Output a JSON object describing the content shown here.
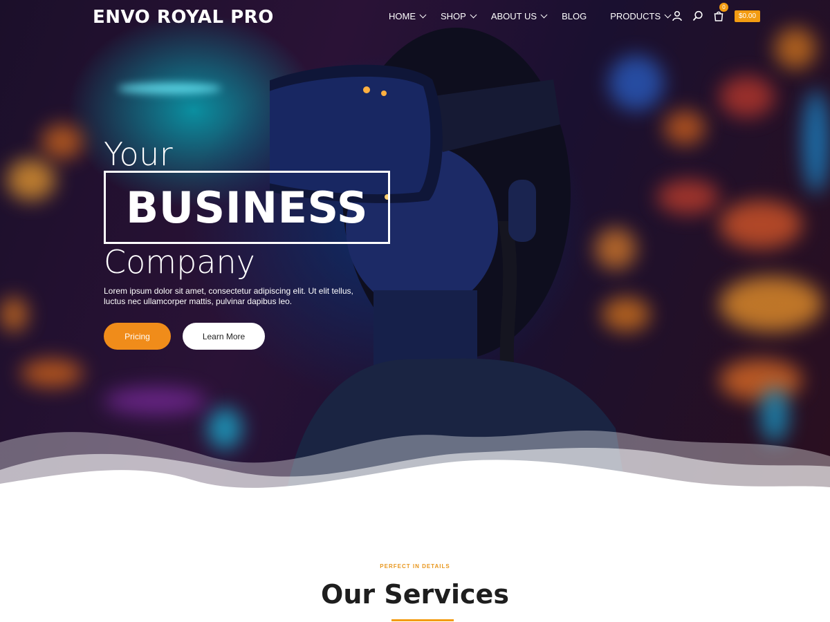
{
  "brand": {
    "logo_text": "ENVO ROYAL PRO"
  },
  "nav": {
    "items": [
      {
        "label": "HOME",
        "has_dropdown": true
      },
      {
        "label": "SHOP",
        "has_dropdown": true
      },
      {
        "label": "ABOUT US",
        "has_dropdown": true
      },
      {
        "label": "BLOG",
        "has_dropdown": false
      },
      {
        "label": "PRODUCTS",
        "has_dropdown": true
      }
    ],
    "icons": [
      "user-icon",
      "search-icon",
      "cart-icon"
    ],
    "cart_count": "0",
    "cart_total": "$0.00"
  },
  "hero": {
    "line1": "Your",
    "line2": "BUSINESS",
    "line3": "Company",
    "description": "Lorem ipsum dolor sit amet, consectetur adipiscing elit. Ut elit tellus, luctus nec ullamcorper mattis, pulvinar dapibus leo.",
    "buttons": {
      "primary": "Pricing",
      "secondary": "Learn More"
    }
  },
  "services": {
    "tagline": "PERFECT IN DETAILS",
    "title": "Our Services"
  },
  "colors": {
    "accent": "#f39c12",
    "white": "#ffffff",
    "dark": "#1e1e1e"
  }
}
